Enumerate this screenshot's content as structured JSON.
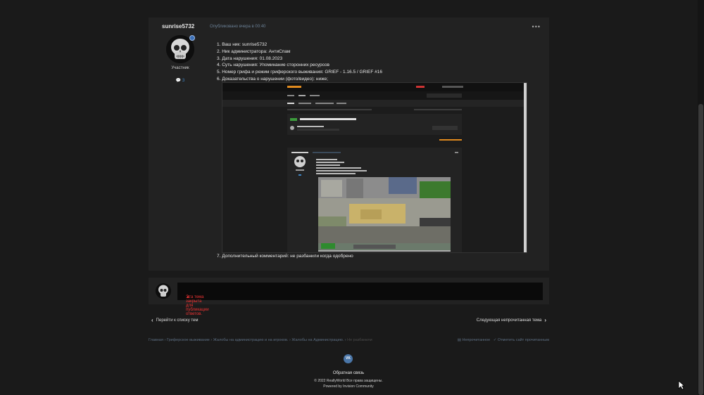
{
  "post": {
    "author": "sunrise5732",
    "role": "Участник",
    "reputation": "3",
    "published": "Опубликовано вчера в 00:40",
    "more_label": "•••",
    "lines": [
      "1. Ваш ник: sunrise5732",
      "2. Ник администратора: АнтиСпам",
      "3. Дата нарушения: 01.08.2023",
      "4. Суть нарушения: Упоминание сторонних ресурсов",
      "5. Номер грифа и режим гриферского выживания: GRIEF - 1.16.5  /  GRIEF #16",
      "6. Доказательства о нарушении (фото/видео): ниже;"
    ],
    "additional": "7. Дополнительный комментарий: не разбанили когда одобрено"
  },
  "locked_message": "Эта тема закрыта для публикации ответов.",
  "navigation": {
    "prev": "Перейти к списку тем",
    "next": "Следующая непрочитанная тема"
  },
  "breadcrumbs": [
    "Главная",
    "Гриферское выживание",
    "Жалобы на администрацию и на игроков.",
    "Жалобы на Администрацию.",
    "Не разбанили"
  ],
  "breadcrumb_actions": [
    "Непрочитанное",
    "Отметить сайт прочитанным"
  ],
  "footer": {
    "vk": "VK",
    "contact": "Обратная связь",
    "copyright": "© 2022 ReallyWorld Все права защищены.",
    "powered": "Powered by Invision Community"
  },
  "icons": {
    "badge": "member-badge-icon",
    "rep": "comment-icon",
    "lock": "warning-icon",
    "prev": "chevron-left-icon",
    "next": "chevron-right-icon"
  },
  "colors": {
    "accent": "#3f86c6",
    "locked": "#e33333",
    "background": "#1a1a1a",
    "panel": "#222222"
  }
}
